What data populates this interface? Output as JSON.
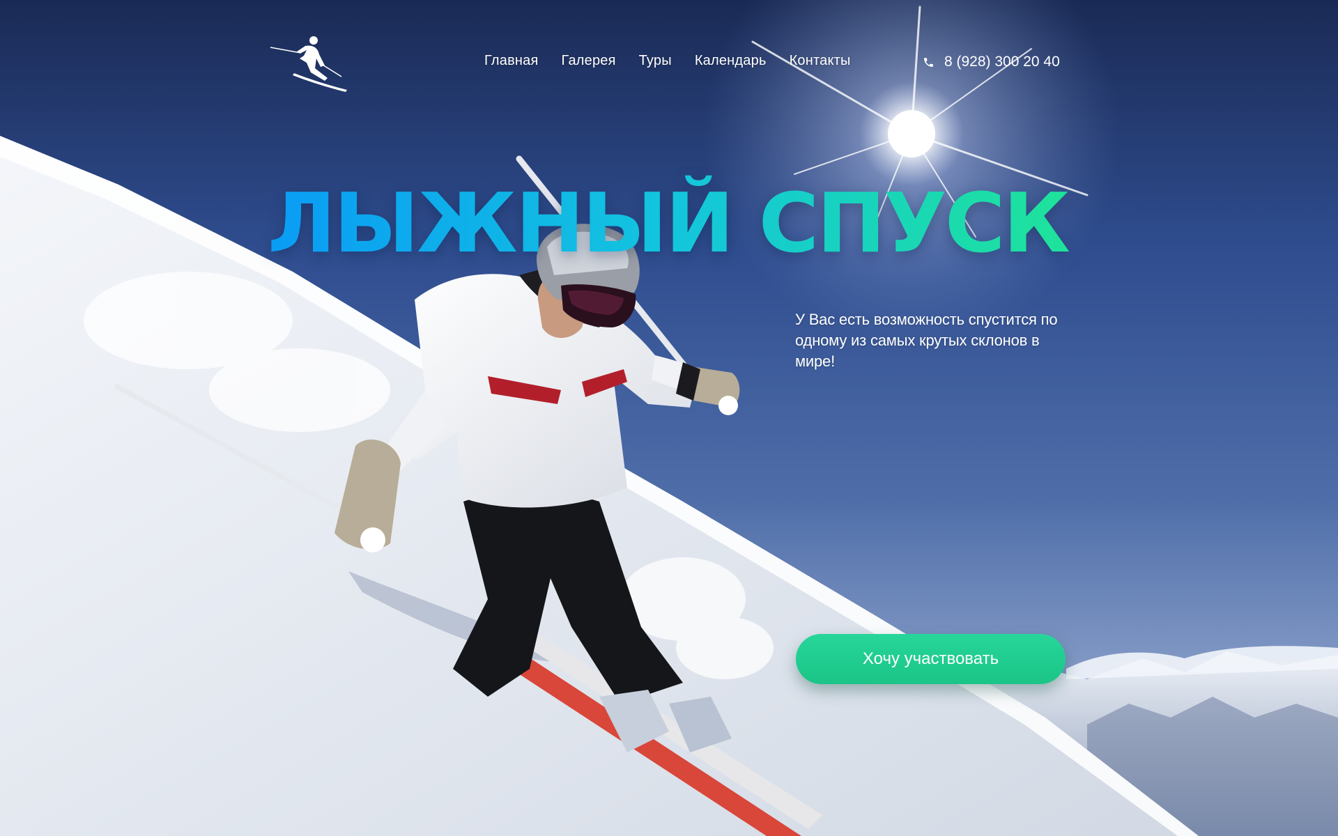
{
  "header": {
    "logo_icon": "skier-icon",
    "nav": [
      {
        "label": "Главная"
      },
      {
        "label": "Галерея"
      },
      {
        "label": "Туры"
      },
      {
        "label": "Календарь"
      },
      {
        "label": "Контакты"
      }
    ],
    "phone_icon": "phone-icon",
    "phone": "8 (928) 300 20 40"
  },
  "hero": {
    "title": "ЛЫЖНЫЙ СПУСК",
    "description": "У Вас есть возможность спустится по одному из самых крутых склонов в мире!",
    "cta_label": "Хочу участвовать",
    "photo": "skier-on-slope-photo"
  },
  "colors": {
    "title_gradient_start": "#0a9cf5",
    "title_gradient_end": "#1ee39a",
    "cta": "#1fcd8f",
    "sky": "#2f4d8f"
  }
}
